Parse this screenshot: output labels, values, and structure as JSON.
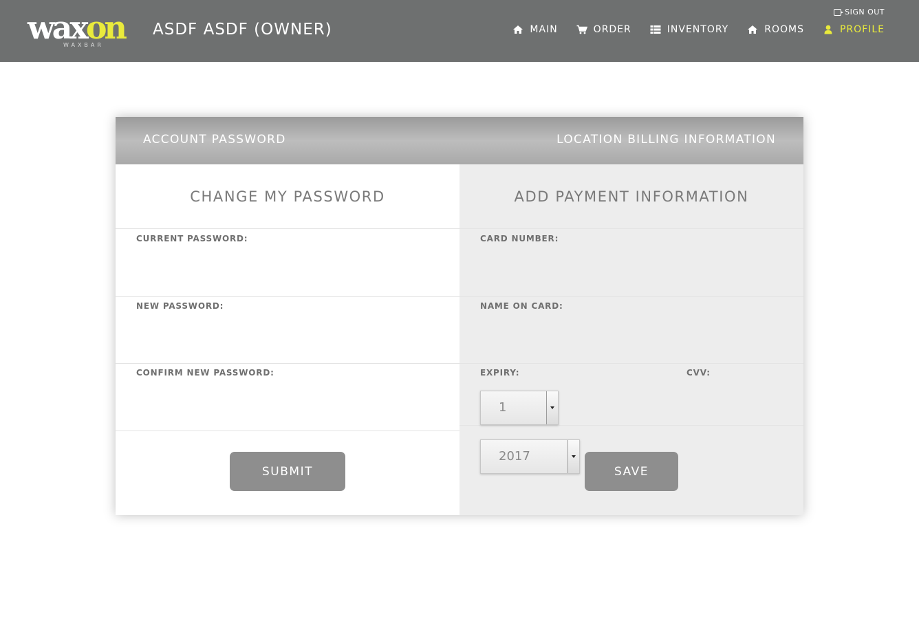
{
  "header": {
    "logo": {
      "word_main": "wax",
      "word_accent": "on",
      "subtitle": "WAXBAR"
    },
    "user_title": "ASDF ASDF (OWNER)",
    "sign_out": "SIGN OUT",
    "nav": [
      {
        "label": "MAIN",
        "icon": "home-icon"
      },
      {
        "label": "ORDER",
        "icon": "cart-icon"
      },
      {
        "label": "INVENTORY",
        "icon": "list-icon"
      },
      {
        "label": "ROOMS",
        "icon": "home-icon"
      },
      {
        "label": "PROFILE",
        "icon": "user-icon",
        "active": true
      }
    ]
  },
  "tabs": {
    "left": "ACCOUNT PASSWORD",
    "right": "LOCATION BILLING INFORMATION"
  },
  "password": {
    "title": "CHANGE MY PASSWORD",
    "current_label": "CURRENT PASSWORD:",
    "current_value": "",
    "new_label": "NEW PASSWORD:",
    "new_value": "",
    "confirm_label": "CONFIRM NEW PASSWORD:",
    "confirm_value": "",
    "submit_label": "SUBMIT"
  },
  "payment": {
    "title": "ADD PAYMENT INFORMATION",
    "card_number_label": "CARD NUMBER:",
    "card_number_value": "",
    "name_label": "NAME ON CARD:",
    "name_value": "",
    "expiry_label": "EXPIRY:",
    "cvv_label": "CVV:",
    "expiry_month": "1",
    "expiry_year": "2017",
    "save_label": "SAVE"
  },
  "colors": {
    "header_bg": "#6e7070",
    "accent": "#e9ea3c",
    "button_bg": "#8e8e8e",
    "right_pane_bg": "#ededed"
  }
}
